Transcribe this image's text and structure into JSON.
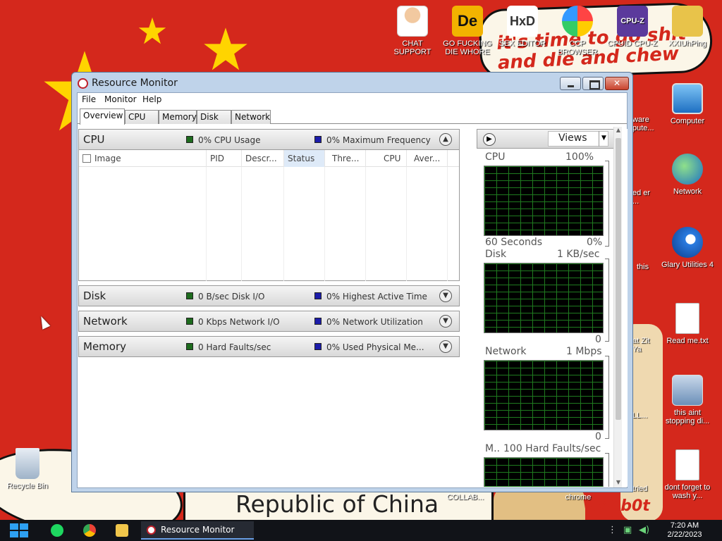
{
  "desktop": {
    "banner_text": "it's time to go shit and die and chew",
    "bottom_banner": "Republic of China",
    "watermark": "VM0b0t",
    "icons": [
      {
        "label": "CHAT SUPPORT",
        "icon": "doctor-icon"
      },
      {
        "label": "GO FUCKING DIE WHORE",
        "icon": "die-tool-icon"
      },
      {
        "label": "SEX EDITOR",
        "icon": "hxd-icon"
      },
      {
        "label": "CCP BROWSER",
        "icon": "browser-icon"
      },
      {
        "label": "CPUID CPU-Z",
        "icon": "cpuz-icon"
      },
      {
        "label": "XXIUhPing",
        "icon": "user-folder-icon"
      },
      {
        "label": "Computer",
        "icon": "computer-icon"
      },
      {
        "label": "Network",
        "icon": "network-icon"
      },
      {
        "label": "Glary Utilities 4",
        "icon": "glary-icon"
      },
      {
        "label": "Read me.txt",
        "icon": "text-file-icon"
      },
      {
        "label": "this aint stopping di...",
        "icon": "installer-icon"
      },
      {
        "label": "dont forget to wash y...",
        "icon": "calendar-file-icon"
      },
      {
        "label": "Recycle Bin",
        "icon": "recycle-bin-icon"
      },
      {
        "label": "COLLAB...",
        "icon": "partial-icon"
      },
      {
        "label": "chrome",
        "icon": "partial-icon"
      },
      {
        "label": "ware pute...",
        "icon": "partial-icon"
      },
      {
        "label": "ed er ...",
        "icon": "partial-icon"
      },
      {
        "label": "this",
        "icon": "partial-icon"
      },
      {
        "label": "at Zit Ya",
        "icon": "partial-icon"
      },
      {
        "label": "LL...",
        "icon": "partial-icon"
      },
      {
        "label": "tried",
        "icon": "partial-icon"
      }
    ]
  },
  "window": {
    "title": "Resource Monitor",
    "menu": [
      "File",
      "Monitor",
      "Help"
    ],
    "tabs": [
      "Overview",
      "CPU",
      "Memory",
      "Disk",
      "Network"
    ],
    "active_tab": "Overview",
    "sections": {
      "cpu": {
        "title": "CPU",
        "stat1": "0% CPU Usage",
        "stat2": "0% Maximum Frequency"
      },
      "disk": {
        "title": "Disk",
        "stat1": "0 B/sec Disk I/O",
        "stat2": "0% Highest Active Time"
      },
      "network": {
        "title": "Network",
        "stat1": "0 Kbps Network I/O",
        "stat2": "0% Network Utilization"
      },
      "memory": {
        "title": "Memory",
        "stat1": "0 Hard Faults/sec",
        "stat2": "0% Used Physical Me..."
      }
    },
    "cpu_columns": [
      "Image",
      "PID",
      "Descr...",
      "Status",
      "Thre...",
      "CPU",
      "Aver..."
    ],
    "sorted_column": "Status",
    "views_label": "Views",
    "graphs": {
      "cpu": {
        "label": "CPU",
        "max": "100%",
        "time": "60 Seconds",
        "min": "0%"
      },
      "disk": {
        "label": "Disk",
        "max": "1 KB/sec",
        "min": "0"
      },
      "network": {
        "label": "Network",
        "max": "1 Mbps",
        "min": "0"
      },
      "memory": {
        "label": "M..",
        "max": "100 Hard Faults/sec"
      }
    }
  },
  "taskbar": {
    "window_label": "Resource Monitor",
    "time": "7:20 AM",
    "date": "2/22/2023"
  },
  "colors": {
    "desktop_bg": "#d4281c",
    "star": "#ffd400",
    "graph_grid": "#1f7a1f",
    "stat_green": "#1d6b1d",
    "stat_blue": "#1c1caa"
  }
}
